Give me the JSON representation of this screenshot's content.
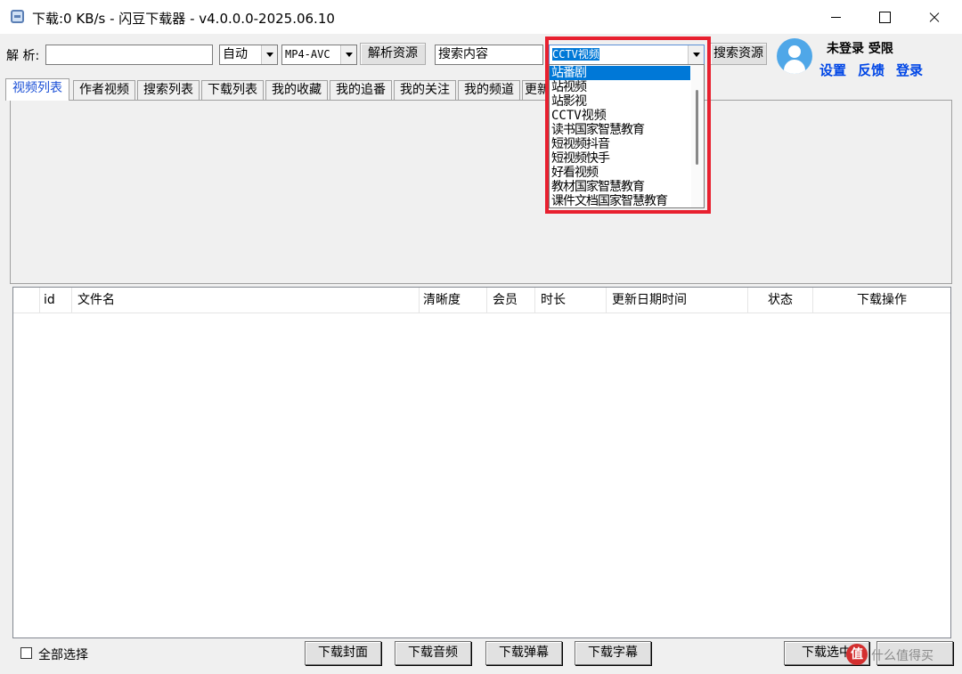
{
  "window": {
    "title": "下载:0 KB/s - 闪豆下载器 - v4.0.0.0-2025.06.10"
  },
  "toolbar": {
    "parse_label": "解 析:",
    "parse_input_value": "",
    "quality_select": "自动",
    "format_select": "MP4-AVC",
    "parse_button": "解析资源",
    "search_input_value": "搜索内容",
    "source_select": "CCTV视频",
    "search_button": "搜索资源"
  },
  "source_dropdown": {
    "options": [
      "站番剧",
      "站视频",
      "站影视",
      "CCTV视频",
      "读书国家智慧教育",
      "短视频抖音",
      "短视频快手",
      "好看视频",
      "教材国家智慧教育",
      "课件文档国家智慧教育"
    ],
    "selected_index": 0
  },
  "user": {
    "status": "未登录 受限",
    "settings_link": "设置",
    "feedback_link": "反馈",
    "login_link": "登录",
    "avatar_icon": "user-avatar-icon",
    "avatar_color": "#4fa7e8"
  },
  "tabs": [
    {
      "label": "视频列表"
    },
    {
      "label": "作者视频"
    },
    {
      "label": "搜索列表"
    },
    {
      "label": "下载列表"
    },
    {
      "label": "我的收藏"
    },
    {
      "label": "我的追番"
    },
    {
      "label": "我的关注"
    },
    {
      "label": "我的频道"
    },
    {
      "label": "更新"
    }
  ],
  "table": {
    "columns": [
      "",
      "id",
      "文件名",
      "清晰度",
      "会员",
      "时长",
      "更新日期时间",
      "状态",
      "下载操作"
    ],
    "rows": []
  },
  "bottom": {
    "select_all_label": "全部选择",
    "download_cover": "下载封面",
    "download_audio": "下载音频",
    "download_danmaku": "下载弹幕",
    "download_subtitle": "下载字幕",
    "download_selected": "下载选中"
  },
  "watermark": {
    "badge": "值",
    "text": "什么值得买"
  },
  "colors": {
    "accent": "#0078d7",
    "link": "#0046e6",
    "highlight_box": "#e8202f",
    "active_tab_text": "#1a4fd6"
  }
}
